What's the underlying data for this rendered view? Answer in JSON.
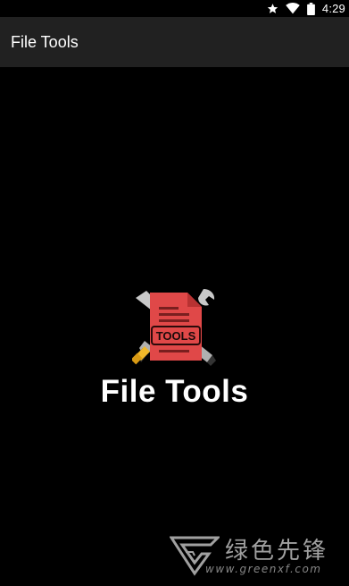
{
  "status_bar": {
    "time": "4:29",
    "icons": [
      "star-icon",
      "wifi-icon",
      "battery-icon"
    ]
  },
  "app_bar": {
    "title": "File Tools"
  },
  "splash": {
    "logo_text": "TOOLS",
    "title": "File Tools",
    "colors": {
      "document": "#e04848",
      "document_fold": "#b83232",
      "tool_metal": "#b0b0b0",
      "tool_handle": "#333333",
      "key_gold": "#f0b82a"
    }
  },
  "watermark": {
    "chinese": "绿色先锋",
    "url": "www.greenxf.com"
  },
  "colors": {
    "background": "#000000",
    "app_bar": "#212121",
    "text": "#ffffff"
  }
}
